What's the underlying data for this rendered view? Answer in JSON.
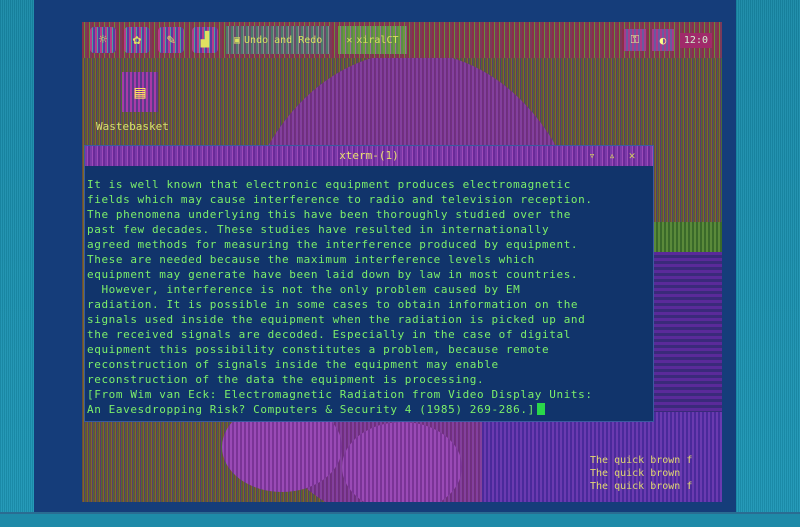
{
  "taskbar": {
    "tasks": [
      {
        "label": "Undo and Redo"
      },
      {
        "label": "xiralCT"
      }
    ],
    "clock": "12:0"
  },
  "desktop": {
    "icon_label": "Wastebasket"
  },
  "terminal": {
    "title": "xterm-(1)",
    "lines": [
      "It is well known that electronic equipment produces electromagnetic",
      "fields which may cause interference to radio and television reception.",
      "The phenomena underlying this have been thoroughly studied over the",
      "past few decades. These studies have resulted in internationally",
      "agreed methods for measuring the interference produced by equipment.",
      "These are needed because the maximum interference levels which",
      "equipment may generate have been laid down by law in most countries.",
      "  However, interference is not the only problem caused by EM",
      "radiation. It is possible in some cases to obtain information on the",
      "signals used inside the equipment when the radiation is picked up and",
      "the received signals are decoded. Especially in the case of digital",
      "equipment this possibility constitutes a problem, because remote",
      "reconstruction of signals inside the equipment may enable",
      "reconstruction of the data the equipment is processing.",
      "[From Wim van Eck: Electromagnetic Radiation from Video Display Units:",
      "An Eavesdropping Risk? Computers & Security 4 (1985) 269-286.]"
    ]
  },
  "notes": [
    "The quick brown f",
    "The quick brown",
    "The quick brown f"
  ]
}
